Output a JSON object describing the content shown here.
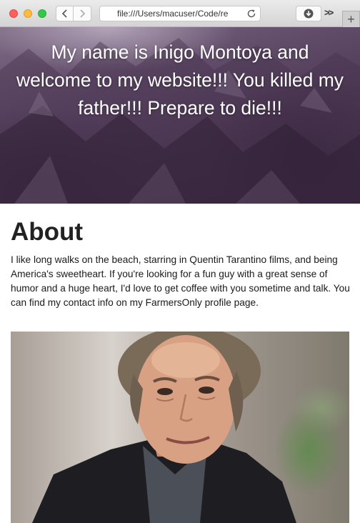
{
  "browser": {
    "url": "file:///Users/macuser/Code/re",
    "overflow_label": ">>",
    "newtab_label": "+"
  },
  "hero": {
    "title": "My name is Inigo Montoya and welcome to my website!!! You killed my father!!! Prepare to die!!!"
  },
  "about": {
    "heading": "About",
    "body": "I like long walks on the beach, starring in Quentin Tarantino films, and being America's sweetheart. If you're looking for a fun guy with a great sense of humor and a huge heart, I'd love to get coffee with you sometime and talk. You can find my contact info on my FarmersOnly profile page."
  },
  "colors": {
    "close": "#fc605c",
    "minimize": "#fdbc40",
    "zoom": "#34c84a",
    "hero_text": "#ffffff",
    "heading_text": "#222222"
  },
  "icons": [
    "back-icon",
    "forward-icon",
    "reload-icon",
    "download-icon",
    "overflow-icon",
    "plus-icon"
  ]
}
